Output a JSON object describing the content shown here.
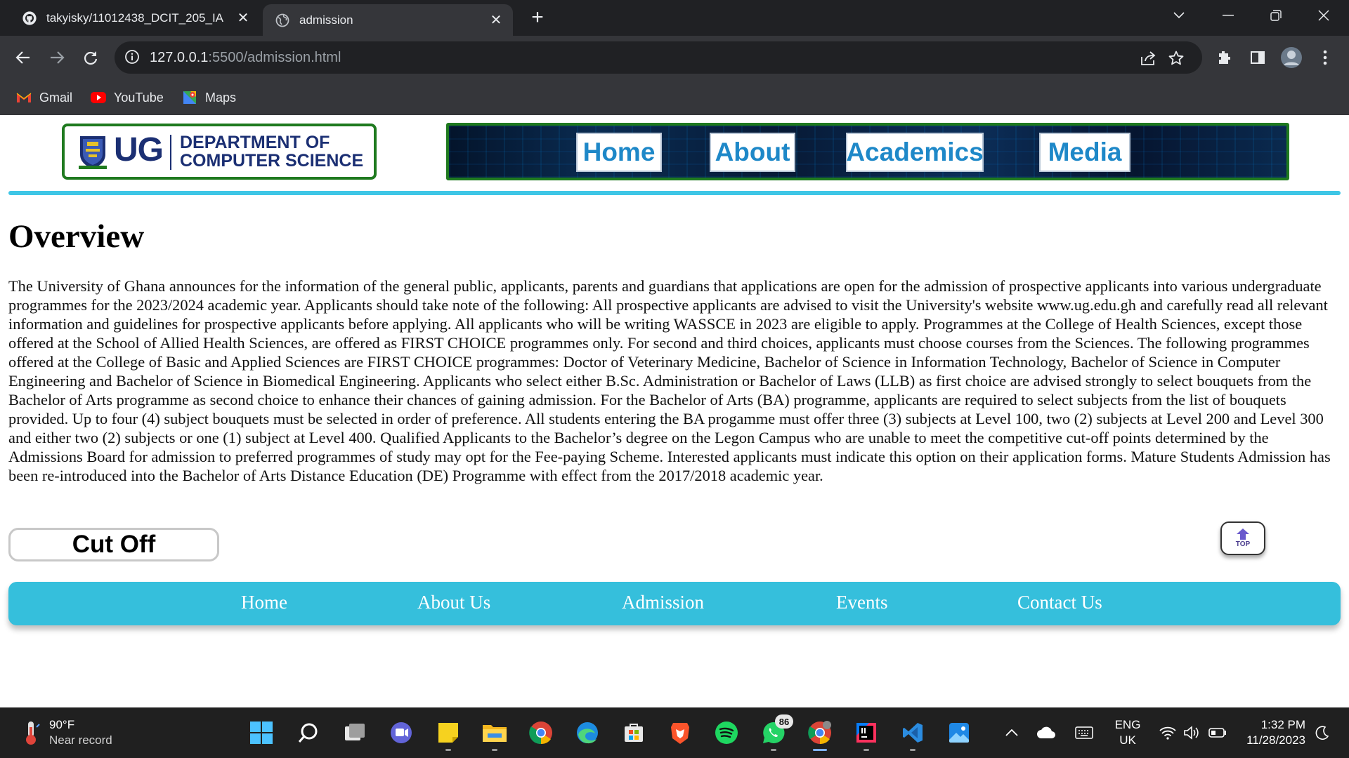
{
  "browser": {
    "tabs": [
      {
        "title": "takyisky/11012438_DCIT_205_IA",
        "icon": "github-icon",
        "active": false
      },
      {
        "title": "admission",
        "icon": "globe-icon",
        "active": true
      }
    ],
    "new_tab_label": "+",
    "address": {
      "host": "127.0.0.1",
      "rest": ":5500/admission.html"
    },
    "bookmarks": [
      {
        "label": "Gmail",
        "icon": "gmail-icon"
      },
      {
        "label": "YouTube",
        "icon": "youtube-icon"
      },
      {
        "label": "Maps",
        "icon": "maps-icon"
      }
    ]
  },
  "site": {
    "logo": {
      "ug": "UG",
      "dept_line1": "DEPARTMENT OF",
      "dept_line2": "COMPUTER SCIENCE"
    },
    "nav": [
      "Home",
      "About",
      "Academics",
      "Media"
    ],
    "overview_title": "Overview",
    "overview_text": "The University of Ghana announces for the information of the general public, applicants, parents and guardians that applications are open for the admission of prospective applicants into various undergraduate programmes for the 2023/2024 academic year. Applicants should take note of the following: All prospective applicants are advised to visit the University's website www.ug.edu.gh and carefully read all relevant information and guidelines for prospective applicants before applying. All applicants who will be writing WASSCE in 2023 are eligible to apply. Programmes at the College of Health Sciences, except those offered at the School of Allied Health Sciences, are offered as FIRST CHOICE programmes only. For second and third choices, applicants must choose courses from the Sciences. The following programmes offered at the College of Basic and Applied Sciences are FIRST CHOICE programmes: Doctor of Veterinary Medicine, Bachelor of Science in Information Technology, Bachelor of Science in Computer Engineering and Bachelor of Science in Biomedical Engineering. Applicants who select either B.Sc. Administration or Bachelor of Laws (LLB) as first choice are advised strongly to select bouquets from the Bachelor of Arts programme as second choice to enhance their chances of gaining admission. For the Bachelor of Arts (BA) programme, applicants are required to select subjects from the list of bouquets provided. Up to four (4) subject bouquets must be selected in order of preference. All students entering the BA progamme must offer three (3) subjects at Level 100, two (2) subjects at Level 200 and Level 300 and either two (2) subjects or one (1) subject at Level 400. Qualified Applicants to the Bachelor’s degree on the Legon Campus who are unable to meet the competitive cut-off points determined by the Admissions Board for admission to preferred programmes of study may opt for the Fee-paying Scheme. Interested applicants must indicate this option on their application forms. Mature Students Admission has been re-introduced into the Bachelor of Arts Distance Education (DE) Programme with effect from the 2017/2018 academic year.",
    "cutoff_button": "Cut Off",
    "top_button": "TOP",
    "footer_nav": [
      "Home",
      "About Us",
      "Admission",
      "Events",
      "Contact Us"
    ],
    "colors": {
      "accent_cyan": "#35bfdc",
      "nav_text": "#1e88c8",
      "logo_navy": "#1b2f73",
      "border_green": "#1f7a1f"
    }
  },
  "taskbar": {
    "weather": {
      "temp": "90°F",
      "desc": "Near record"
    },
    "apps": [
      "start-icon",
      "search-icon",
      "task-view-icon",
      "teams-chat-icon",
      "sticky-notes-icon",
      "file-explorer-icon",
      "chrome-icon",
      "edge-icon",
      "store-icon",
      "brave-icon",
      "spotify-icon",
      "whatsapp-icon",
      "chrome-profile-icon",
      "intellij-icon",
      "vscode-icon",
      "photos-icon"
    ],
    "whatsapp_badge": "86",
    "lang": {
      "line1": "ENG",
      "line2": "UK"
    },
    "time": "1:32 PM",
    "date": "11/28/2023"
  }
}
